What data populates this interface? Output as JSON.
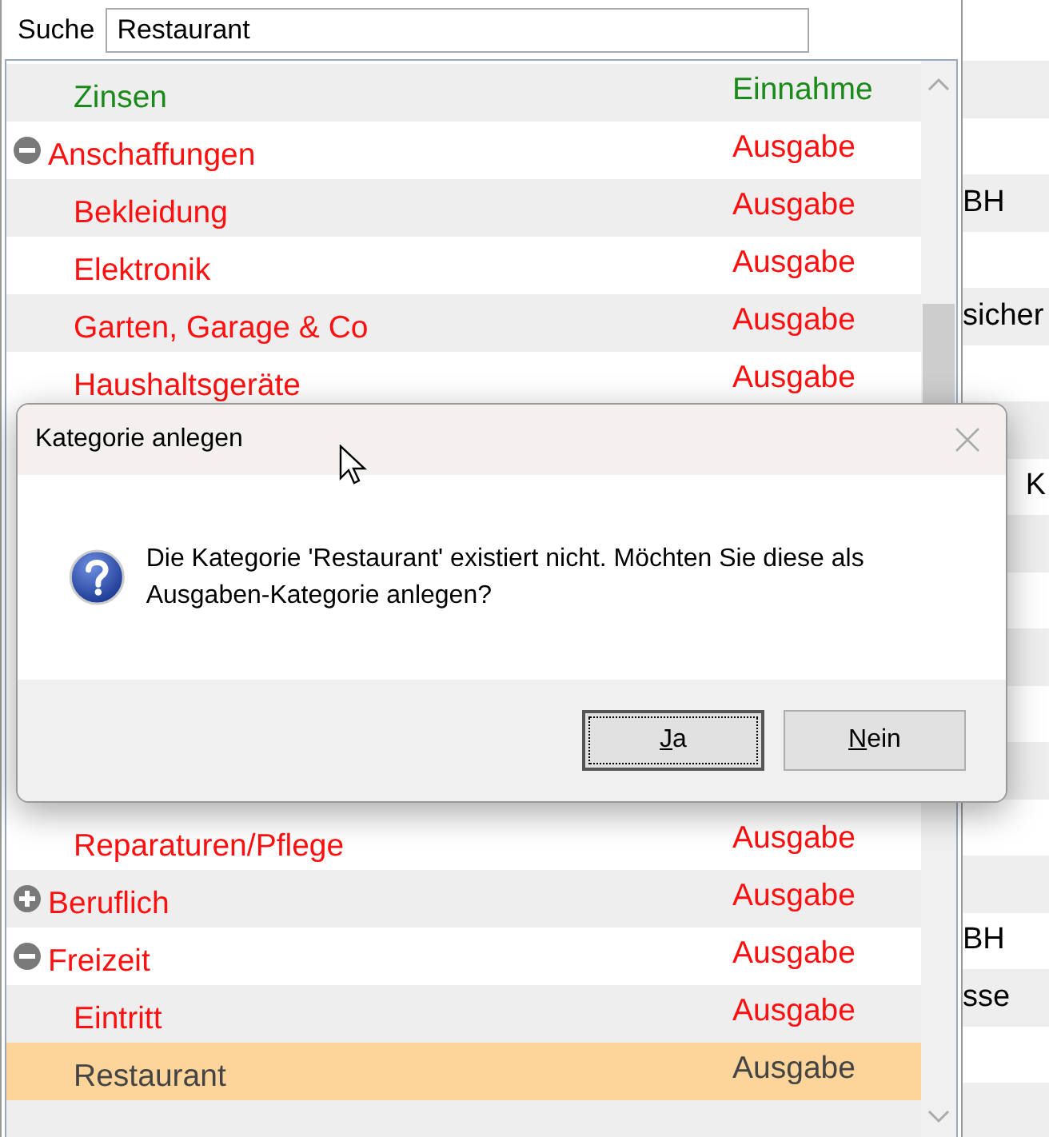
{
  "search": {
    "label": "Suche",
    "value": "Restaurant"
  },
  "tree": [
    {
      "children": [
        {
          "name": "Zinsen",
          "type": "Einnahme",
          "kind": "income",
          "selected": false
        }
      ]
    },
    {
      "name": "Anschaffungen",
      "type": "Ausgabe",
      "kind": "expense",
      "expanded": true,
      "selected": false,
      "children": [
        {
          "name": "Bekleidung",
          "type": "Ausgabe",
          "kind": "expense",
          "selected": false
        },
        {
          "name": "Elektronik",
          "type": "Ausgabe",
          "kind": "expense",
          "selected": false
        },
        {
          "name": "Garten, Garage & Co",
          "type": "Ausgabe",
          "kind": "expense",
          "selected": false
        },
        {
          "name": "Haushaltsgeräte",
          "type": "Ausgabe",
          "kind": "expense",
          "selected": false
        }
      ]
    },
    {
      "children": [
        {
          "name": "Reparaturen/Pflege",
          "type": "Ausgabe",
          "kind": "expense",
          "selected": false
        }
      ]
    },
    {
      "name": "Beruflich",
      "type": "Ausgabe",
      "kind": "expense",
      "expanded": false,
      "selected": false
    },
    {
      "name": "Freizeit",
      "type": "Ausgabe",
      "kind": "expense",
      "expanded": true,
      "selected": false,
      "children": [
        {
          "name": "Eintritt",
          "type": "Ausgabe",
          "kind": "expense",
          "selected": false
        },
        {
          "name": "Restaurant",
          "type": "Ausgabe",
          "kind": "expense",
          "selected": true
        }
      ]
    }
  ],
  "background_list": [
    "BH",
    "sicher",
    "K",
    "BH",
    "sse"
  ],
  "dialog": {
    "title": "Kategorie anlegen",
    "message": "Die Kategorie 'Restaurant' existiert nicht. Möchten Sie diese als Ausgaben-Kategorie anlegen?",
    "buttons": [
      {
        "label": "Ja",
        "focused": true
      },
      {
        "label": "Nein",
        "focused": false
      }
    ]
  }
}
